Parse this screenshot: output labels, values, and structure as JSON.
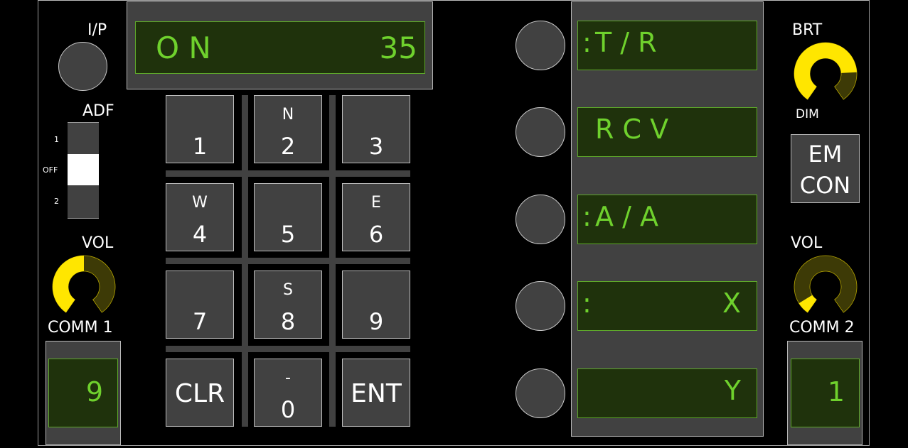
{
  "colors": {
    "lcd_bg": "#1f320c",
    "lcd_text": "#6fd12d",
    "lcd_border": "#5ea82a",
    "plate": "#414141",
    "knob_on": "#ffe600",
    "knob_off": "#3d3a06"
  },
  "left": {
    "ip_label": "I/P",
    "adf": {
      "label": "ADF",
      "positions": [
        "1",
        "OFF",
        "2"
      ],
      "selected": "OFF"
    },
    "vol_label": "VOL",
    "vol_level": 0.5,
    "comm_label": "COMM 1",
    "comm_channel": "9"
  },
  "scratchpad": {
    "left_text": "O N",
    "right_text": "35"
  },
  "keypad": [
    {
      "main": "1",
      "sub": ""
    },
    {
      "main": "2",
      "sub": "N"
    },
    {
      "main": "3",
      "sub": ""
    },
    {
      "main": "4",
      "sub": "W"
    },
    {
      "main": "5",
      "sub": ""
    },
    {
      "main": "6",
      "sub": "E"
    },
    {
      "main": "7",
      "sub": ""
    },
    {
      "main": "8",
      "sub": "S"
    },
    {
      "main": "9",
      "sub": ""
    },
    {
      "main": "CLR",
      "sub": ""
    },
    {
      "main": "0",
      "sub": "-"
    },
    {
      "main": "ENT",
      "sub": ""
    }
  ],
  "options": [
    {
      "cue": ":",
      "left": "T / R",
      "right": ""
    },
    {
      "cue": "",
      "left": "R C V",
      "right": ""
    },
    {
      "cue": ":",
      "left": "A / A",
      "right": ""
    },
    {
      "cue": ":",
      "left": "",
      "right": "X"
    },
    {
      "cue": "",
      "left": "",
      "right": "Y"
    }
  ],
  "right": {
    "brt_label": "BRT",
    "dim_label": "DIM",
    "brt_level": 0.8,
    "emcon_line1": "EM",
    "emcon_line2": "CON",
    "vol_label": "VOL",
    "vol_level": 0.08,
    "comm_label": "COMM 2",
    "comm_channel": "1"
  }
}
